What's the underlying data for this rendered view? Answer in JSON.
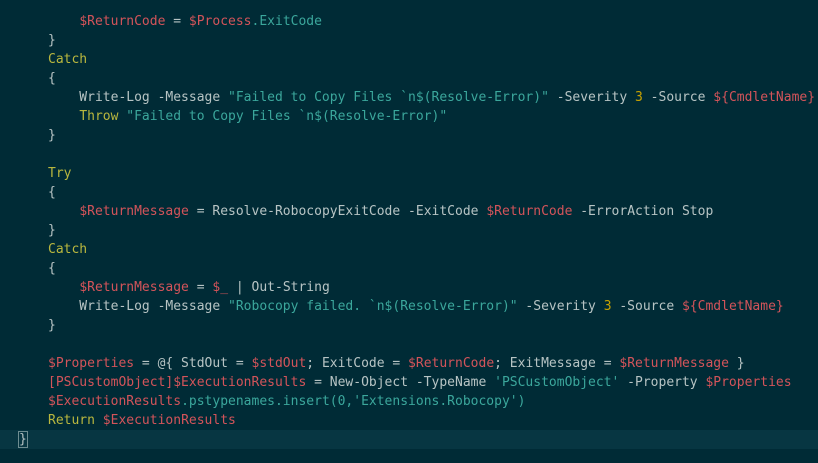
{
  "editor": {
    "theme_colors": {
      "background": "#002b36",
      "current_line": "#073642",
      "keyword": "#b9b73e",
      "variable": "#d3545a",
      "string": "#3ba79c",
      "number": "#c8a200",
      "text": "#b7c4c4"
    },
    "lines": [
      [
        {
          "t": "    "
        },
        {
          "c": "var",
          "t": "$ReturnCode"
        },
        {
          "t": " = "
        },
        {
          "c": "var",
          "t": "$Process"
        },
        {
          "c": "str",
          "t": ".ExitCode"
        }
      ],
      [
        {
          "t": "}"
        }
      ],
      [
        {
          "c": "kw",
          "t": "Catch"
        }
      ],
      [
        {
          "t": "{"
        }
      ],
      [
        {
          "t": "    Write-Log -Message "
        },
        {
          "c": "str",
          "t": "\"Failed to Copy Files `n$(Resolve-Error)\""
        },
        {
          "t": " -Severity "
        },
        {
          "c": "num",
          "t": "3"
        },
        {
          "t": " -Source "
        },
        {
          "c": "var",
          "t": "${CmdletName}"
        }
      ],
      [
        {
          "t": "    "
        },
        {
          "c": "kw",
          "t": "Throw"
        },
        {
          "t": " "
        },
        {
          "c": "str",
          "t": "\"Failed to Copy Files `n$(Resolve-Error)\""
        }
      ],
      [
        {
          "t": "}"
        }
      ],
      [
        {
          "t": ""
        }
      ],
      [
        {
          "c": "kw",
          "t": "Try"
        }
      ],
      [
        {
          "t": "{"
        }
      ],
      [
        {
          "t": "    "
        },
        {
          "c": "var",
          "t": "$ReturnMessage"
        },
        {
          "t": " = Resolve-RobocopyExitCode -ExitCode "
        },
        {
          "c": "var",
          "t": "$ReturnCode"
        },
        {
          "t": " -ErrorAction Stop"
        }
      ],
      [
        {
          "t": "}"
        }
      ],
      [
        {
          "c": "kw",
          "t": "Catch"
        }
      ],
      [
        {
          "t": "{"
        }
      ],
      [
        {
          "t": "    "
        },
        {
          "c": "var",
          "t": "$ReturnMessage"
        },
        {
          "t": " = "
        },
        {
          "c": "var",
          "t": "$_"
        },
        {
          "t": " | Out-String"
        }
      ],
      [
        {
          "t": "    Write-Log -Message "
        },
        {
          "c": "str",
          "t": "\"Robocopy failed. `n$(Resolve-Error)\""
        },
        {
          "t": " -Severity "
        },
        {
          "c": "num",
          "t": "3"
        },
        {
          "t": " -Source "
        },
        {
          "c": "var",
          "t": "${CmdletName}"
        }
      ],
      [
        {
          "t": "}"
        }
      ],
      [
        {
          "t": ""
        }
      ],
      [
        {
          "c": "var",
          "t": "$Properties"
        },
        {
          "t": " = @{ StdOut = "
        },
        {
          "c": "var",
          "t": "$stdOut"
        },
        {
          "t": "; ExitCode = "
        },
        {
          "c": "var",
          "t": "$ReturnCode"
        },
        {
          "t": "; ExitMessage = "
        },
        {
          "c": "var",
          "t": "$ReturnMessage"
        },
        {
          "t": " }"
        }
      ],
      [
        {
          "c": "var",
          "t": "[PSCustomObject]$ExecutionResults"
        },
        {
          "t": " = New-Object -TypeName "
        },
        {
          "c": "str",
          "t": "'PSCustomObject'"
        },
        {
          "t": " -Property "
        },
        {
          "c": "var",
          "t": "$Properties"
        }
      ],
      [
        {
          "c": "var",
          "t": "$ExecutionResults"
        },
        {
          "c": "str",
          "t": ".pstypenames.insert(0,'Extensions.Robocopy')"
        }
      ],
      [
        {
          "c": "kw",
          "t": "Return"
        },
        {
          "t": " "
        },
        {
          "c": "var",
          "t": "$ExecutionResults"
        }
      ],
      [
        {
          "t": "}",
          "cursor": true
        }
      ]
    ]
  }
}
